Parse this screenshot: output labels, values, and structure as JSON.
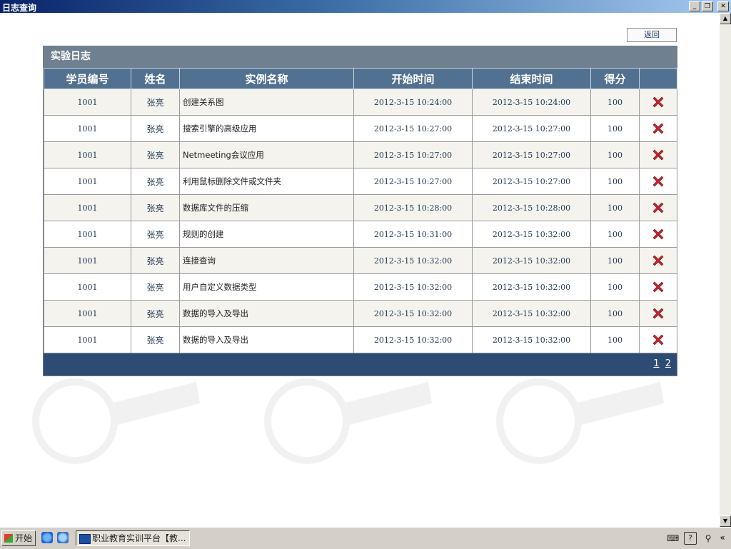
{
  "window": {
    "title": "日志查询",
    "minimize_icon": "minimize-icon",
    "restore_icon": "restore-icon",
    "close_icon": "close-icon"
  },
  "toolbar": {
    "back_label": "返回"
  },
  "panel": {
    "title": "实验日志",
    "columns": [
      "学员编号",
      "姓名",
      "实例名称",
      "开始时间",
      "结束时间",
      "得分",
      ""
    ],
    "rows": [
      {
        "id": "1001",
        "name": "张亮",
        "example": "创建关系图",
        "start": "2012-3-15 10:24:00",
        "end": "2012-3-15 10:24:00",
        "score": "100"
      },
      {
        "id": "1001",
        "name": "张亮",
        "example": "搜索引擎的高级应用",
        "start": "2012-3-15 10:27:00",
        "end": "2012-3-15 10:27:00",
        "score": "100"
      },
      {
        "id": "1001",
        "name": "张亮",
        "example": "Netmeeting会议应用",
        "start": "2012-3-15 10:27:00",
        "end": "2012-3-15 10:27:00",
        "score": "100"
      },
      {
        "id": "1001",
        "name": "张亮",
        "example": "利用鼠标删除文件或文件夹",
        "start": "2012-3-15 10:27:00",
        "end": "2012-3-15 10:27:00",
        "score": "100"
      },
      {
        "id": "1001",
        "name": "张亮",
        "example": "数据库文件的压缩",
        "start": "2012-3-15 10:28:00",
        "end": "2012-3-15 10:28:00",
        "score": "100"
      },
      {
        "id": "1001",
        "name": "张亮",
        "example": "规则的创建",
        "start": "2012-3-15 10:31:00",
        "end": "2012-3-15 10:32:00",
        "score": "100"
      },
      {
        "id": "1001",
        "name": "张亮",
        "example": "连接查询",
        "start": "2012-3-15 10:32:00",
        "end": "2012-3-15 10:32:00",
        "score": "100"
      },
      {
        "id": "1001",
        "name": "张亮",
        "example": "用户自定义数据类型",
        "start": "2012-3-15 10:32:00",
        "end": "2012-3-15 10:32:00",
        "score": "100"
      },
      {
        "id": "1001",
        "name": "张亮",
        "example": "数据的导入及导出",
        "start": "2012-3-15 10:32:00",
        "end": "2012-3-15 10:32:00",
        "score": "100"
      },
      {
        "id": "1001",
        "name": "张亮",
        "example": "数据的导入及导出",
        "start": "2012-3-15 10:32:00",
        "end": "2012-3-15 10:32:00",
        "score": "100"
      }
    ],
    "delete_icon": "delete-x-icon",
    "delete_color": "#c0272d",
    "pager": {
      "pages": [
        "1",
        "2"
      ],
      "current": "1"
    }
  },
  "colors": {
    "panel_header": "#6f8090",
    "column_header": "#52708f",
    "footer": "#2d4b73"
  },
  "taskbar": {
    "start_label": "开始",
    "task_label": "职业教育实训平台【教...",
    "tray_icons": [
      "keyboard-icon",
      "help-icon",
      "pin-icon"
    ],
    "expand_label": "«"
  }
}
